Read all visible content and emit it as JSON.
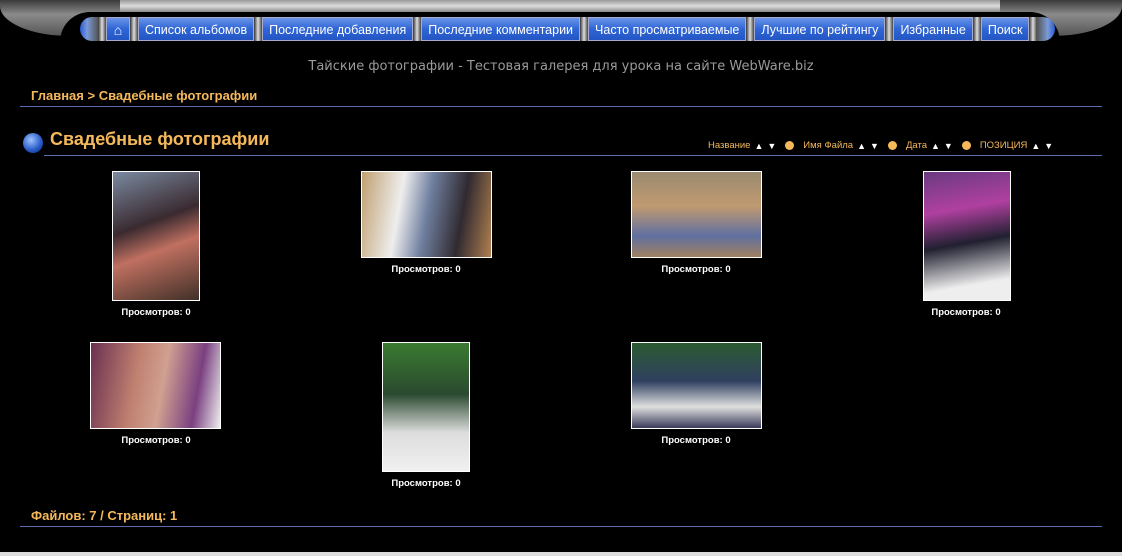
{
  "nav": {
    "home_icon": "house-icon",
    "items": [
      "Список альбомов",
      "Последние добавления",
      "Последние комментарии",
      "Часто просматриваемые",
      "Лучшие по рейтингу",
      "Избранные",
      "Поиск"
    ]
  },
  "subtitle": "Тайские фотографии - Тестовая галерея для урока на сайте WebWare.biz",
  "breadcrumb": {
    "home": "Главная",
    "sep": ">",
    "current": "Свадебные фотографии"
  },
  "album_title": "Свадебные фотографии",
  "sort": {
    "items": [
      "Название",
      "Имя Файла",
      "Дата",
      "ПОЗИЦИЯ"
    ],
    "up": "▲",
    "down": "▼"
  },
  "thumbs": [
    {
      "caption": "Просмотров: 0"
    },
    {
      "caption": "Просмотров: 0"
    },
    {
      "caption": "Просмотров: 0"
    },
    {
      "caption": "Просмотров: 0"
    },
    {
      "caption": "Просмотров: 0"
    },
    {
      "caption": "Просмотров: 0"
    },
    {
      "caption": "Просмотров: 0"
    }
  ],
  "footer": "Файлов: 7 / Страниц: 1"
}
